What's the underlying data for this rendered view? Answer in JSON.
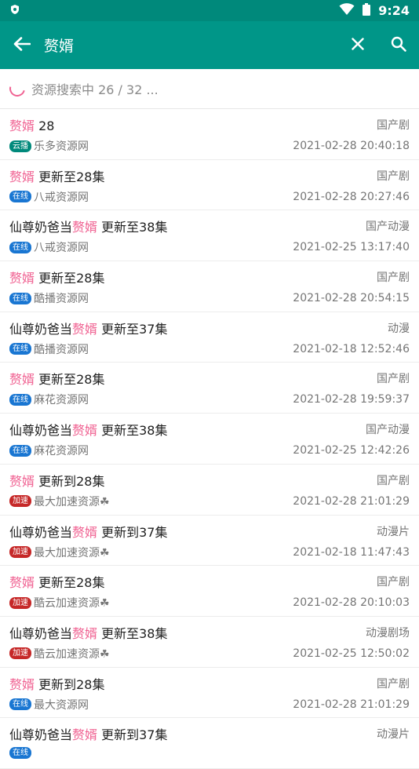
{
  "status_bar": {
    "time": "9:24",
    "shield_icon": "shield-icon",
    "wifi_icon": "wifi-icon",
    "battery_icon": "battery-icon"
  },
  "app_bar": {
    "query": "赘婿",
    "back_icon": "arrow-left-icon",
    "clear_icon": "close-icon",
    "search_icon": "search-icon"
  },
  "search_status": {
    "text": "资源搜索中 26 / 32 ..."
  },
  "badge_colors": {
    "云播": "#00897b",
    "在线": "#1976d2",
    "加速": "#c62828"
  },
  "highlight_color": "#f06292",
  "results": [
    {
      "prefix": "",
      "keyword": "赘婿",
      "suffix": " 28",
      "category": "国产剧",
      "badge": "云播",
      "source": "乐多资源网",
      "date": "2021-02-28 20:40:18"
    },
    {
      "prefix": "",
      "keyword": "赘婿",
      "suffix": " 更新至28集",
      "category": "国产剧",
      "badge": "在线",
      "source": "八戒资源网",
      "date": "2021-02-28 20:27:46"
    },
    {
      "prefix": "仙尊奶爸当",
      "keyword": "赘婿",
      "suffix": " 更新至38集",
      "category": "国产动漫",
      "badge": "在线",
      "source": "八戒资源网",
      "date": "2021-02-25 13:17:40"
    },
    {
      "prefix": "",
      "keyword": "赘婿",
      "suffix": " 更新至28集",
      "category": "国产剧",
      "badge": "在线",
      "source": "酷播资源网",
      "date": "2021-02-28 20:54:15"
    },
    {
      "prefix": "仙尊奶爸当",
      "keyword": "赘婿",
      "suffix": " 更新至37集",
      "category": "动漫",
      "badge": "在线",
      "source": "酷播资源网",
      "date": "2021-02-18 12:52:46"
    },
    {
      "prefix": "",
      "keyword": "赘婿",
      "suffix": " 更新至28集",
      "category": "国产剧",
      "badge": "在线",
      "source": "麻花资源网",
      "date": "2021-02-28 19:59:37"
    },
    {
      "prefix": "仙尊奶爸当",
      "keyword": "赘婿",
      "suffix": " 更新至38集",
      "category": "国产动漫",
      "badge": "在线",
      "source": "麻花资源网",
      "date": "2021-02-25 12:42:26"
    },
    {
      "prefix": "",
      "keyword": "赘婿",
      "suffix": " 更新到28集",
      "category": "国产剧",
      "badge": "加速",
      "source": "最大加速资源☘",
      "date": "2021-02-28 21:01:29"
    },
    {
      "prefix": "仙尊奶爸当",
      "keyword": "赘婿",
      "suffix": " 更新到37集",
      "category": "动漫片",
      "badge": "加速",
      "source": "最大加速资源☘",
      "date": "2021-02-18 11:47:43"
    },
    {
      "prefix": "",
      "keyword": "赘婿",
      "suffix": " 更新至28集",
      "category": "国产剧",
      "badge": "加速",
      "source": "酷云加速资源☘",
      "date": "2021-02-28 20:10:03"
    },
    {
      "prefix": "仙尊奶爸当",
      "keyword": "赘婿",
      "suffix": " 更新至38集",
      "category": "动漫剧场",
      "badge": "加速",
      "source": "酷云加速资源☘",
      "date": "2021-02-25 12:50:02"
    },
    {
      "prefix": "",
      "keyword": "赘婿",
      "suffix": " 更新到28集",
      "category": "国产剧",
      "badge": "在线",
      "source": "最大资源网",
      "date": "2021-02-28 21:01:29"
    },
    {
      "prefix": "仙尊奶爸当",
      "keyword": "赘婿",
      "suffix": " 更新到37集",
      "category": "动漫片",
      "badge": "在线",
      "source": "",
      "date": ""
    }
  ]
}
